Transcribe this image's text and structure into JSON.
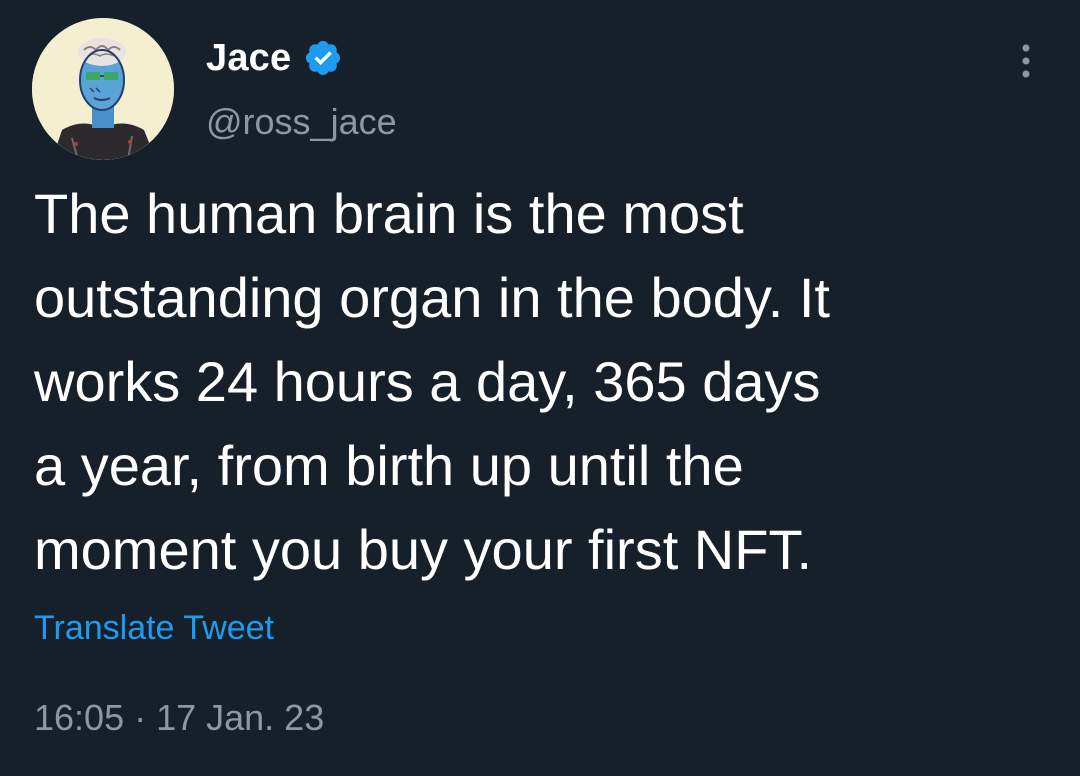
{
  "tweet": {
    "author": {
      "display_name": "Jace",
      "handle": "@ross_jace",
      "verified": true,
      "avatar": "nft-avatar-blue-figure"
    },
    "text": "The human brain is the most\noutstanding organ in the body. It\nworks 24 hours a day, 365 days\na year, from birth up until the\nmoment you buy your first NFT.",
    "translate_label": "Translate Tweet",
    "timestamp": "16:05 · 17 Jan. 23",
    "more_icon": "more-vertical-icon",
    "verified_icon": "verified-badge-icon"
  },
  "colors": {
    "background": "#15202b",
    "text": "#ffffff",
    "secondary_text": "#8b98a5",
    "accent": "#1d9bf0"
  }
}
